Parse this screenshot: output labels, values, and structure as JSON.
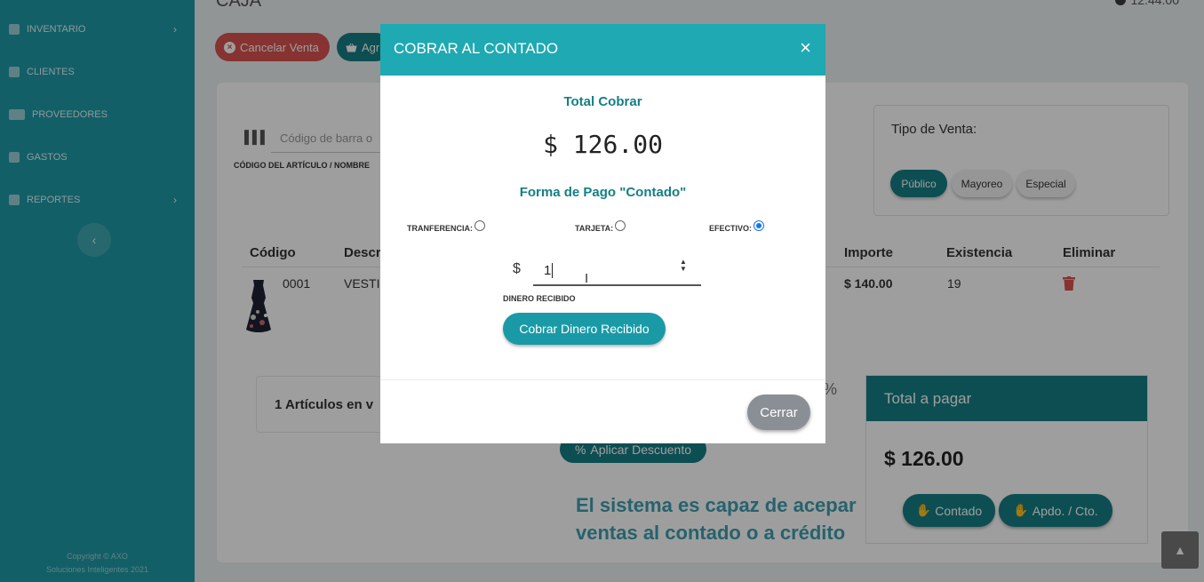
{
  "sidebar": {
    "items": [
      {
        "label": "INVENTARIO",
        "chevron": "›"
      },
      {
        "label": "CLIENTES",
        "chevron": ""
      },
      {
        "label": "PROVEEDORES",
        "chevron": ""
      },
      {
        "label": "GASTOS",
        "chevron": ""
      },
      {
        "label": "REPORTES",
        "chevron": "›"
      }
    ],
    "collapse_label": "‹",
    "copyright_line1": "Copyright © AXO",
    "copyright_line2": "Soluciones Inteligentes 2021"
  },
  "header": {
    "title": "CAJA",
    "clock": "12:44:00"
  },
  "toolbar": {
    "cancel_label": "Cancelar Venta",
    "add_label": "Agr"
  },
  "barcode": {
    "placeholder": "Código de barra o",
    "label": "CÓDIGO DEL ARTÍCULO / NOMBRE"
  },
  "tipo_venta": {
    "label": "Tipo de Venta:",
    "options": [
      "Público",
      "Mayoreo",
      "Especial"
    ],
    "selected": "Público"
  },
  "table": {
    "headers": [
      "Código",
      "Descr",
      "Importe",
      "Existencia",
      "Eliminar"
    ],
    "rows": [
      {
        "codigo": "0001",
        "descripcion": "VESTI",
        "importe": "$ 140.00",
        "existencia": "19"
      }
    ]
  },
  "summary": {
    "articles_text": "1 Artículos en v",
    "percent_symbol": "%",
    "discount_label": "Aplicar Descuento",
    "caption_line1": "El sistema es capaz de acepar",
    "caption_line2": "ventas al contado o a crédito"
  },
  "total": {
    "header": "Total a pagar",
    "amount": "$ 126.00",
    "contado_label": "Contado",
    "apdo_label": "Apdo. / Cto."
  },
  "modal": {
    "title": "COBRAR AL CONTADO",
    "close_symbol": "×",
    "total_cobrar_label": "Total Cobrar",
    "amount": "$ 126.00",
    "forma_pago_label": "Forma de Pago \"Contado\"",
    "payment_options": [
      {
        "label": "TRANFERENCIA:",
        "checked": false
      },
      {
        "label": "TARJETA:",
        "checked": false
      },
      {
        "label": "EFECTIVO:",
        "checked": true
      }
    ],
    "currency_symbol": "$",
    "input_value": "1",
    "dinero_label": "DINERO RECIBIDO",
    "cobrar_button": "Cobrar Dinero Recibido",
    "cerrar_button": "Cerrar"
  },
  "colors": {
    "sidebar": "#1f9aa6",
    "accent_dark": "#157e85",
    "modal_header": "#1fa9b2",
    "danger": "#d9534f",
    "caption": "#3e9fb0"
  },
  "icons": {
    "sidebar": [
      "box-icon",
      "user-icon",
      "truck-icon",
      "money-icon",
      "chart-icon"
    ],
    "cancel": "times-circle-icon",
    "add": "basket-icon",
    "barcode": "barcode-icon",
    "delete": "trash-icon",
    "discount": "percent-icon",
    "pay": "hand-holding-dollar-icon",
    "scroll_top": "chevron-up-icon"
  }
}
